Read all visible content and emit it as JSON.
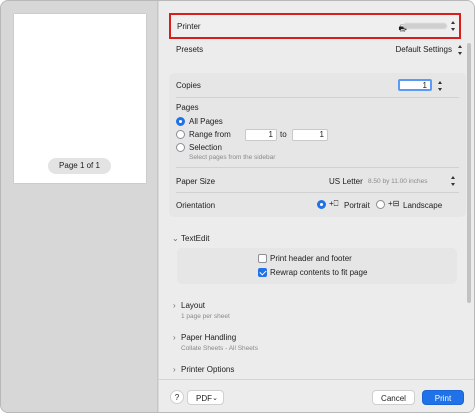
{
  "preview": {
    "page_indicator": "Page 1 of 1"
  },
  "printer": {
    "label": "Printer"
  },
  "presets": {
    "label": "Presets",
    "value": "Default Settings"
  },
  "copies": {
    "label": "Copies",
    "value": "1"
  },
  "pages": {
    "heading": "Pages",
    "all_label": "All Pages",
    "range_label": "Range from",
    "range_from": "1",
    "range_to_label": "to",
    "range_to": "1",
    "selection_label": "Selection",
    "selection_hint": "Select pages from the sidebar",
    "selected": "all"
  },
  "paper_size": {
    "label": "Paper Size",
    "value": "US Letter",
    "detail": "8.50 by 11.00 inches"
  },
  "orientation": {
    "label": "Orientation",
    "portrait_label": "Portrait",
    "landscape_label": "Landscape",
    "selected": "portrait"
  },
  "textedit": {
    "heading": "TextEdit",
    "header_footer_label": "Print header and footer",
    "header_footer_checked": false,
    "rewrap_label": "Rewrap contents to fit page",
    "rewrap_checked": true
  },
  "layout": {
    "heading": "Layout",
    "summary": "1 page per sheet"
  },
  "paper_handling": {
    "heading": "Paper Handling",
    "summary": "Collate Sheets - All Sheets"
  },
  "printer_options": {
    "heading": "Printer Options"
  },
  "footer": {
    "help_label": "?",
    "pdf_label": "PDF",
    "cancel_label": "Cancel",
    "print_label": "Print"
  },
  "colors": {
    "accent": "#1f72e8",
    "highlight_border": "#d91c1c"
  }
}
